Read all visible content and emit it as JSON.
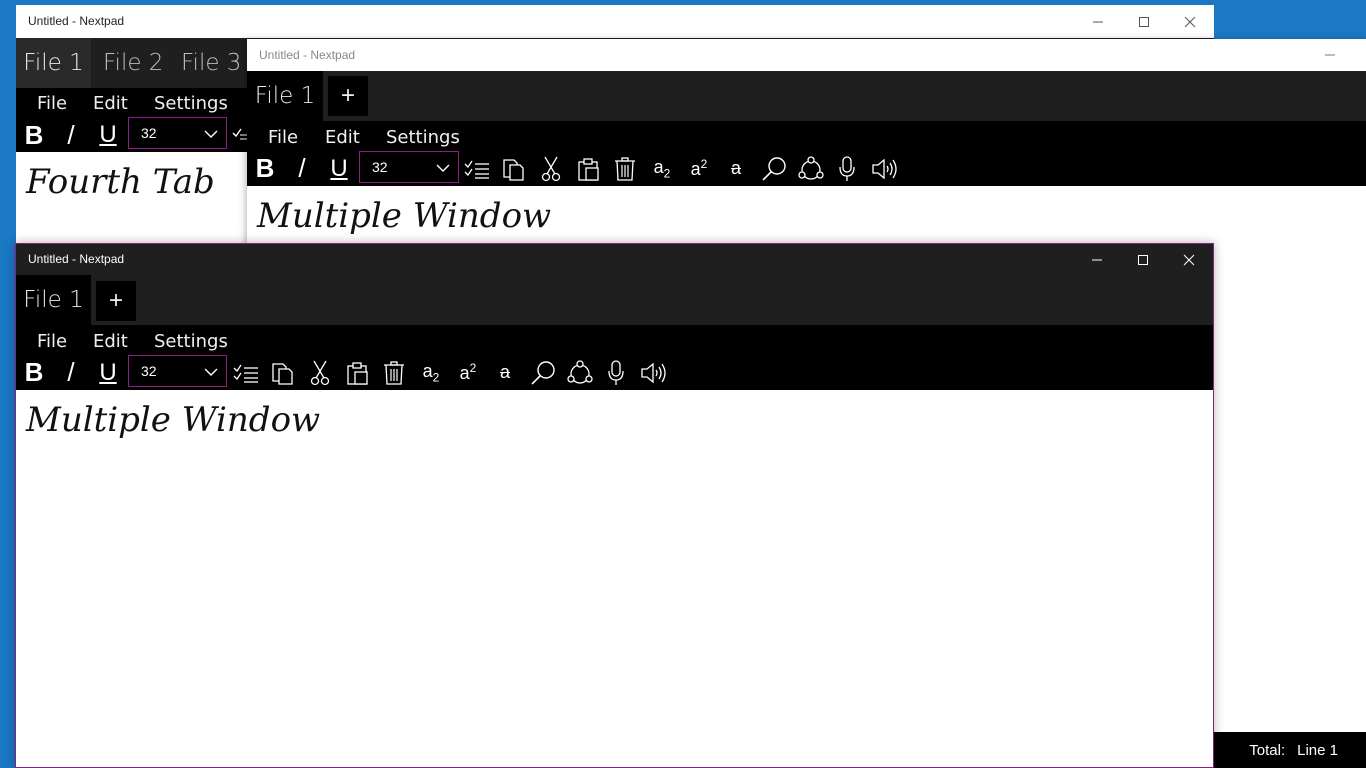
{
  "accent_color": "#8a1f8c",
  "window_back": {
    "title": "Untitled - Nextpad",
    "tabs": [
      "File 1",
      "File 2",
      "File 3"
    ],
    "menu": [
      "File",
      "Edit",
      "Settings"
    ],
    "font_size": "32",
    "content": "Fourth Tab"
  },
  "window_middle": {
    "title": "Untitled - Nextpad",
    "tabs": [
      "File 1"
    ],
    "new_tab": "+",
    "menu": [
      "File",
      "Edit",
      "Settings"
    ],
    "font_size": "32",
    "content": "Multiple Window"
  },
  "window_front": {
    "title": "Untitled - Nextpad",
    "tabs": [
      "File 1"
    ],
    "new_tab": "+",
    "menu": [
      "File",
      "Edit",
      "Settings"
    ],
    "font_size": "32",
    "content": "Multiple Window"
  },
  "statusbar": {
    "total_label": "Total:",
    "line_label": "Line 1"
  },
  "icons": [
    "bold-icon",
    "italic-icon",
    "underline-icon",
    "checklist-icon",
    "copy-icon",
    "cut-icon",
    "paste-icon",
    "delete-icon",
    "subscript-icon",
    "superscript-icon",
    "strikethrough-icon",
    "search-icon",
    "share-icon",
    "microphone-icon",
    "speaker-icon"
  ]
}
